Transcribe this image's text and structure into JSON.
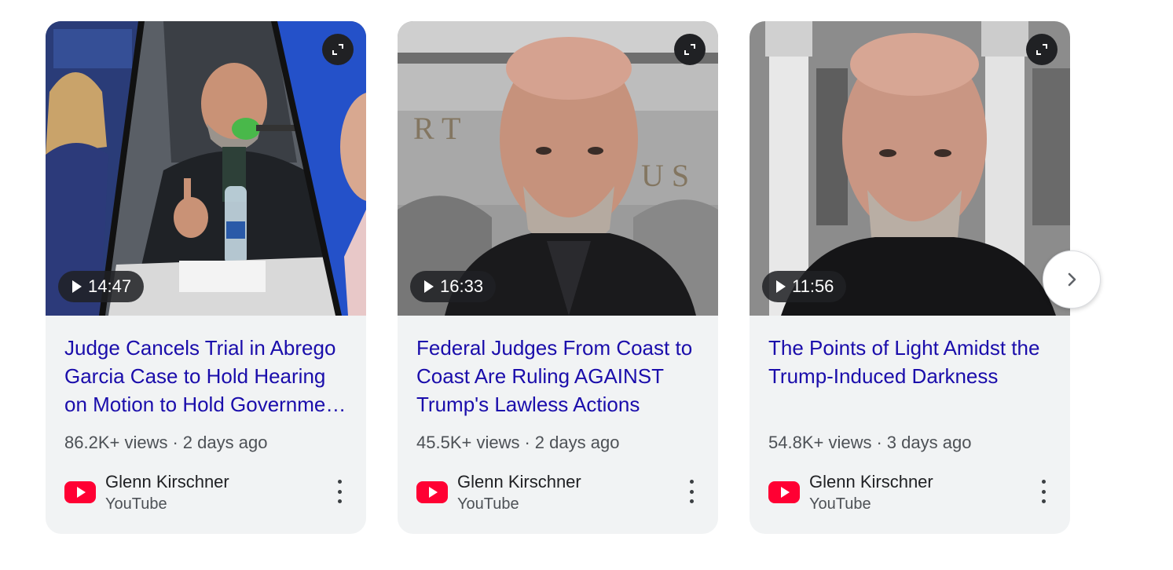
{
  "videos": [
    {
      "duration": "14:47",
      "title": "Judge Cancels Trial in Abrego Garcia Case to Hold Hearing on Motion to Hold Government in Contempt",
      "views": "86.2K+ views",
      "age": "2 days ago",
      "channel": "Glenn Kirschner",
      "source": "YouTube"
    },
    {
      "duration": "16:33",
      "title": "Federal Judges From Coast to Coast Are Ruling AGAINST Trump's Lawless Actions",
      "views": "45.5K+ views",
      "age": "2 days ago",
      "channel": "Glenn Kirschner",
      "source": "YouTube"
    },
    {
      "duration": "11:56",
      "title": "The Points of Light Amidst the Trump-Induced Darkness",
      "views": "54.8K+ views",
      "age": "3 days ago",
      "channel": "Glenn Kirschner",
      "source": "YouTube"
    }
  ],
  "separator": "·",
  "icons": {
    "expand": "expand-icon",
    "play": "play-icon",
    "youtube": "youtube-logo-icon",
    "more": "more-vert-icon",
    "next": "chevron-right-icon"
  },
  "colors": {
    "title_link": "#1a0dab",
    "card_bg": "#f1f3f4",
    "youtube_red": "#ff0033"
  }
}
